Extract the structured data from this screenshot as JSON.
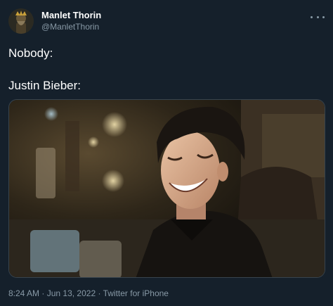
{
  "tweet": {
    "author": {
      "display_name": "Manlet Thorin",
      "handle": "@ManletThorin"
    },
    "text_lines": [
      "Nobody:",
      "Justin Bieber:"
    ],
    "meta": {
      "time": "8:24 AM",
      "date": "Jun 13, 2022",
      "separator": "·",
      "source": "Twitter for iPhone"
    }
  },
  "icons": {
    "more": "more-horizontal-icon",
    "avatar": "avatar-image"
  },
  "colors": {
    "background": "#15202b",
    "secondary_text": "#8899a6",
    "border": "#38444d"
  }
}
